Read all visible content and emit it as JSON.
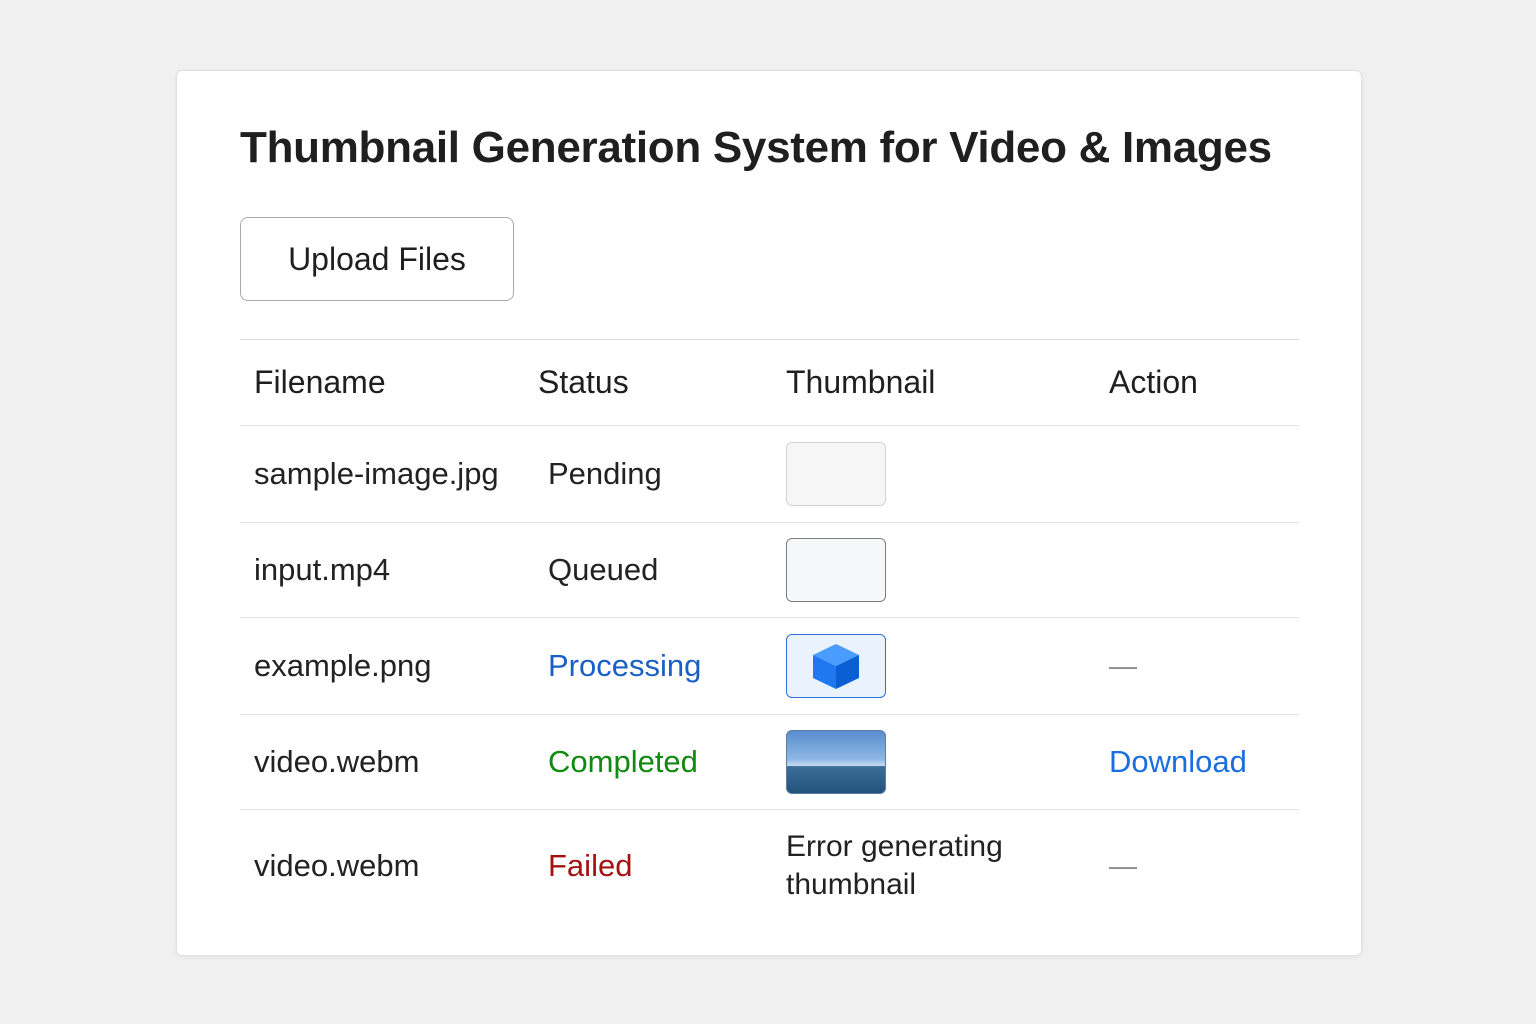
{
  "page": {
    "title": "Thumbnail Generation System for Video & Images",
    "upload_label": "Upload Files"
  },
  "table": {
    "headers": [
      "Filename",
      "Status",
      "Thumbnail",
      "Action"
    ],
    "rows": [
      {
        "filename": "sample-image.jpg",
        "status": "Pending",
        "status_color": "#222222",
        "thumbnail": "empty-light",
        "action": ""
      },
      {
        "filename": "input.mp4",
        "status": "Queued",
        "status_color": "#222222",
        "thumbnail": "empty-dark",
        "action": ""
      },
      {
        "filename": "example.png",
        "status": "Processing",
        "status_color": "#1a5fc4",
        "thumbnail": "cube-icon",
        "action": "—"
      },
      {
        "filename": "video.webm",
        "status": "Completed",
        "status_color": "#118a11",
        "thumbnail": "ocean-image",
        "action": "Download"
      },
      {
        "filename": "video.webm",
        "status": "Failed",
        "status_color": "#a51212",
        "thumbnail_text": "Error generating thumbnail",
        "action": "—"
      }
    ]
  },
  "colors": {
    "link": "#1a6ee0",
    "processing": "#1a5fc4",
    "completed": "#118a11",
    "failed": "#a51212"
  }
}
